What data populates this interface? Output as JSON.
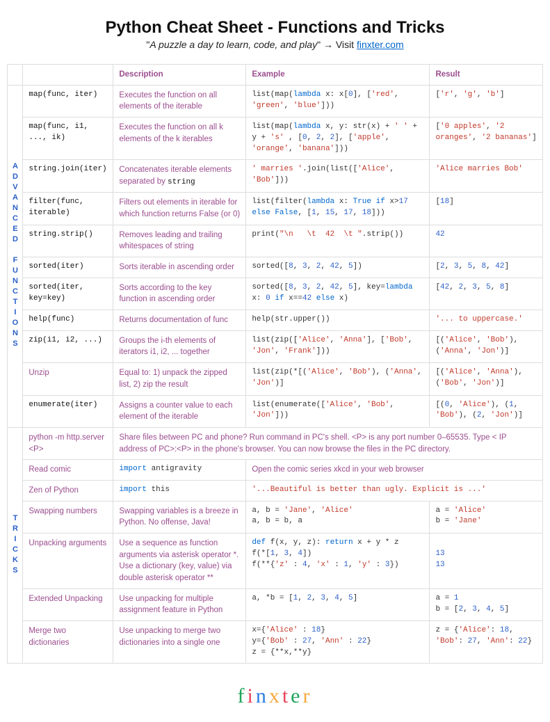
{
  "header": {
    "title": "Python Cheat Sheet - Functions and Tricks",
    "quote": "A puzzle a day to learn, code, and play",
    "visit_prefix": "\" → Visit ",
    "link_text": "finxter.com"
  },
  "columns": {
    "c1": "",
    "c2": "",
    "desc": "Description",
    "example": "Example",
    "result": "Result"
  },
  "side": {
    "advanced": "ADVANCED FUNCTIONS",
    "tricks": "TRICKS"
  },
  "adv": [
    {
      "name": "map(func, iter)",
      "desc": "Executes the function on all elements of the iterable",
      "example": "list(map(<kw>lambda</kw> x: x[<num>0</num>], [<str>'red'</str>, <str>'green'</str>, <str>'blue'</str>]))",
      "result": "[<str>'r'</str>, <str>'g'</str>, <str>'b'</str>]"
    },
    {
      "name": "map(func, i1, ..., ik)",
      "desc": "Executes the function on all k elements of the k iterables",
      "example": "list(map(<kw>lambda</kw> x, y: str(x) + <str>' '</str> + y + <str>'s'</str> , [<num>0</num>, <num>2</num>, <num>2</num>], [<str>'apple'</str>, <str>'orange'</str>, <str>'banana'</str>]))",
      "result": "[<str>'0 apples'</str>, <str>'2 oranges'</str>, <str>'2 bananas'</str>]"
    },
    {
      "name": "string.join(iter)",
      "desc_html": "Concatenates iterable elements separated by <span class='code'>string</span>",
      "example": "<str>' marries '</str>.join(list([<str>'Alice'</str>, <str>'Bob'</str>]))",
      "result": "<str>'Alice marries Bob'</str>"
    },
    {
      "name": "filter(func, iterable)",
      "desc": "Filters out elements in iterable for which function returns False (or 0)",
      "example": "list(filter(<kw>lambda</kw> x: <kw>True if</kw> x><num>17</num> <kw>else False</kw>, [<num>1</num>, <num>15</num>, <num>17</num>, <num>18</num>]))",
      "result": "[<num>18</num>]"
    },
    {
      "name": "string.strip()",
      "desc": "Removes leading and trailing whitespaces of string",
      "example": "print(<str>\"\\n   \\t  42  \\t \"</str>.strip())",
      "result": "<num>42</num>"
    },
    {
      "name": "sorted(iter)",
      "desc": "Sorts iterable in ascending order",
      "example": "sorted([<num>8</num>, <num>3</num>, <num>2</num>, <num>42</num>, <num>5</num>])",
      "result": "[<num>2</num>, <num>3</num>, <num>5</num>, <num>8</num>, <num>42</num>]"
    },
    {
      "name": "sorted(iter, key=key)",
      "desc": "Sorts according to the key function in ascending order",
      "example": "sorted([<num>8</num>, <num>3</num>, <num>2</num>, <num>42</num>, <num>5</num>], key=<kw>lambda</kw> x: <num>0</num> <kw>if</kw> x==<num>42</num> <kw>else</kw> x)",
      "result": "[<num>42</num>, <num>2</num>, <num>3</num>, <num>5</num>, <num>8</num>]"
    },
    {
      "name": "help(func)",
      "desc": "Returns documentation of func",
      "example": "help(str.upper())",
      "result": "<str>'... to uppercase.'</str>"
    },
    {
      "name": "zip(i1, i2, ...)",
      "desc": "Groups the i-th elements of iterators i1, i2, ... together",
      "example": "list(zip([<str>'Alice'</str>, <str>'Anna'</str>], [<str>'Bob'</str>, <str>'Jon'</str>, <str>'Frank'</str>]))",
      "result": "[(<str>'Alice'</str>, <str>'Bob'</str>), (<str>'Anna'</str>, <str>'Jon'</str>)]"
    },
    {
      "name_plain": "Unzip",
      "desc": "Equal to: 1) unpack the zipped list, 2) zip the result",
      "example": "list(zip(*[(<str>'Alice'</str>, <str>'Bob'</str>), (<str>'Anna'</str>, <str>'Jon'</str>)]",
      "result": "[(<str>'Alice'</str>, <str>'Anna'</str>), (<str>'Bob'</str>, <str>'Jon'</str>)]"
    },
    {
      "name": "enumerate(iter)",
      "desc": "Assigns a counter value to each element of the iterable",
      "example": "list(enumerate([<str>'Alice'</str>, <str>'Bob'</str>, <str>'Jon'</str>]))",
      "result": "[(<num>0</num>, <str>'Alice'</str>), (<num>1</num>, <str>'Bob'</str>), (<num>2</num>, <str>'Jon'</str>)]"
    }
  ],
  "tricks": [
    {
      "name": "python -m http.server <P>",
      "desc_span": "Share files between PC and phone? Run command in PC's shell. <P> is any port number 0–65535. Type < IP address of PC>:<P> in the phone's browser. You can now browse the files in the PC directory.",
      "span3": true
    },
    {
      "name": "Read comic",
      "code": "<kw>import</kw> antigravity",
      "note": "Open the comic series xkcd in your web browser",
      "note_span2": true
    },
    {
      "name": "Zen of Python",
      "code": "<kw>import</kw> this",
      "result": "<str>'...Beautiful is better than ugly. Explicit is ...'</str>",
      "result_span2": true
    },
    {
      "name": "Swapping numbers",
      "desc": "Swapping variables is a breeze in Python. No offense, Java!",
      "example": "a, b = <str>'Jane'</str>, <str>'Alice'</str>\na, b = b, a",
      "result": "a = <str>'Alice'</str>\nb = <str>'Jane'</str>"
    },
    {
      "name": "Unpacking arguments",
      "desc": "Use a sequence as function arguments via asterisk operator *. Use a dictionary (key, value) via double asterisk operator **",
      "example": "<kw>def</kw> f(x, y, z): <kw>return</kw> x + y * z\nf(*[<num>1</num>, <num>3</num>, <num>4</num>])\nf(**{<str>'z'</str> : <num>4</num>, <str>'x'</str> : <num>1</num>, <str>'y'</str> : <num>3</num>})",
      "result": "\n<num>13</num>\n<num>13</num>"
    },
    {
      "name": "Extended Unpacking",
      "desc": "Use unpacking for multiple assignment feature in Python",
      "example": "a, *b = [<num>1</num>, <num>2</num>, <num>3</num>, <num>4</num>, <num>5</num>]",
      "result": "a = <num>1</num>\nb = [<num>2</num>, <num>3</num>, <num>4</num>, <num>5</num>]"
    },
    {
      "name": "Merge two dictionaries",
      "desc": "Use unpacking to merge two dictionaries into a single one",
      "example": "x={<str>'Alice'</str> : <num>18</num>}\ny={<str>'Bob'</str> : <num>27</num>, <str>'Ann'</str> : <num>22</num>}\nz = {**x,**y}",
      "result": "z = {<str>'Alice'</str>: <num>18</num>, <str>'Bob'</str>: <num>27</num>, <str>'Ann'</str>: <num>22</num>}"
    }
  ],
  "logo": "finxter"
}
